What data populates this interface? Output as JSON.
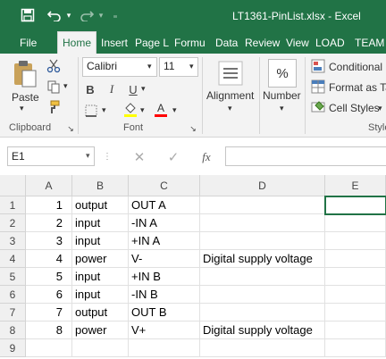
{
  "window": {
    "title": "LT1361-PinList.xlsx - Excel"
  },
  "qat": {
    "save_icon": "save-icon",
    "undo_icon": "undo-icon",
    "redo_icon": "redo-icon",
    "customize_icon": "customize-qat-icon"
  },
  "tabs": [
    {
      "label": "File"
    },
    {
      "label": "Home"
    },
    {
      "label": "Insert"
    },
    {
      "label": "Page L"
    },
    {
      "label": "Formu"
    },
    {
      "label": "Data"
    },
    {
      "label": "Review"
    },
    {
      "label": "View"
    },
    {
      "label": "LOAD "
    },
    {
      "label": "TEAM"
    }
  ],
  "ribbon": {
    "clipboard": {
      "paste_label": "Paste",
      "group_label": "Clipboard"
    },
    "font": {
      "font_name": "Calibri",
      "font_size": "11",
      "bold": "B",
      "italic": "I",
      "underline": "U",
      "group_label": "Font",
      "fill_color": "#ffff00",
      "font_color": "#ff0000"
    },
    "alignment": {
      "label": "Alignment"
    },
    "number": {
      "label": "Number",
      "symbol": "%"
    },
    "styles": {
      "conditional": "Conditional",
      "format_as_table": "Format as Ta",
      "cell_styles": "Cell Styles",
      "group_label": "Style"
    }
  },
  "formula_bar": {
    "name_box": "E1",
    "fx": "fx",
    "formula": ""
  },
  "sheet": {
    "columns": [
      "A",
      "B",
      "C",
      "D",
      "E"
    ],
    "rows": [
      {
        "num": "1",
        "A": "1",
        "B": "output",
        "C": "OUT A",
        "D": ""
      },
      {
        "num": "2",
        "A": "2",
        "B": "input",
        "C": "-IN A",
        "D": ""
      },
      {
        "num": "3",
        "A": "3",
        "B": "input",
        "C": "+IN A",
        "D": ""
      },
      {
        "num": "4",
        "A": "4",
        "B": "power",
        "C": "V-",
        "D": "Digital supply voltage"
      },
      {
        "num": "5",
        "A": "5",
        "B": "input",
        "C": "+IN B",
        "D": ""
      },
      {
        "num": "6",
        "A": "6",
        "B": "input",
        "C": "-IN B",
        "D": ""
      },
      {
        "num": "7",
        "A": "7",
        "B": "output",
        "C": "OUT B",
        "D": ""
      },
      {
        "num": "8",
        "A": "8",
        "B": "power",
        "C": "V+",
        "D": "Digital supply voltage"
      },
      {
        "num": "9",
        "A": "",
        "B": "",
        "C": "",
        "D": ""
      }
    ]
  }
}
